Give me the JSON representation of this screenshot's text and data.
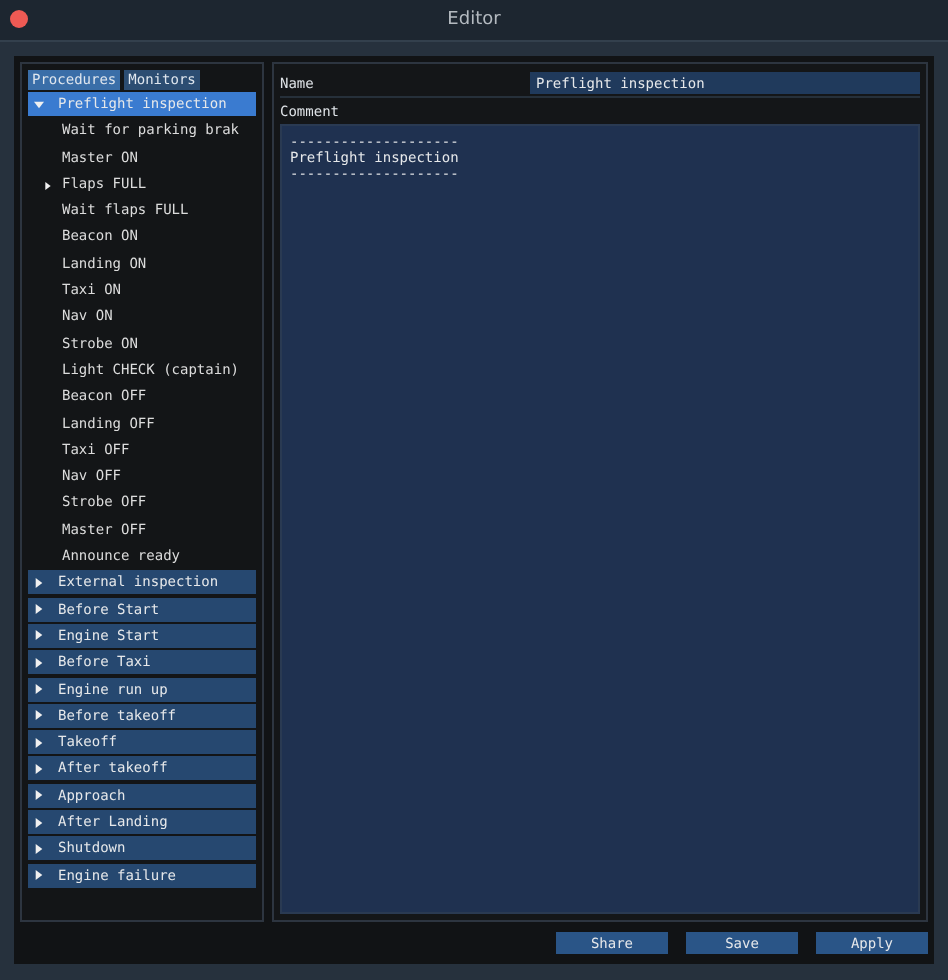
{
  "window": {
    "title": "Editor"
  },
  "tabs": [
    {
      "label": "Procedures",
      "selected": true
    },
    {
      "label": "Monitors",
      "selected": false
    }
  ],
  "tree": [
    {
      "label": "Preflight inspection",
      "expanded": true,
      "selected": true,
      "children": [
        {
          "label": "Wait for parking brak"
        },
        {
          "label": "Master ON"
        },
        {
          "label": "Flaps FULL",
          "expanded": false
        },
        {
          "label": "Wait flaps FULL"
        },
        {
          "label": "Beacon ON"
        },
        {
          "label": "Landing ON"
        },
        {
          "label": "Taxi ON"
        },
        {
          "label": "Nav ON"
        },
        {
          "label": "Strobe ON"
        },
        {
          "label": "Light CHECK (captain)"
        },
        {
          "label": "Beacon OFF"
        },
        {
          "label": "Landing OFF"
        },
        {
          "label": "Taxi OFF"
        },
        {
          "label": "Nav OFF"
        },
        {
          "label": "Strobe OFF"
        },
        {
          "label": "Master OFF"
        },
        {
          "label": "Announce ready"
        }
      ]
    },
    {
      "label": "External inspection",
      "expanded": false,
      "selected": false
    },
    {
      "label": "Before Start",
      "expanded": false,
      "selected": false
    },
    {
      "label": "Engine Start",
      "expanded": false,
      "selected": false
    },
    {
      "label": "Before Taxi",
      "expanded": false,
      "selected": false
    },
    {
      "label": "Engine run up",
      "expanded": false,
      "selected": false
    },
    {
      "label": "Before takeoff",
      "expanded": false,
      "selected": false
    },
    {
      "label": "Takeoff",
      "expanded": false,
      "selected": false
    },
    {
      "label": "After takeoff",
      "expanded": false,
      "selected": false
    },
    {
      "label": "Approach",
      "expanded": false,
      "selected": false
    },
    {
      "label": "After Landing",
      "expanded": false,
      "selected": false
    },
    {
      "label": "Shutdown",
      "expanded": false,
      "selected": false
    },
    {
      "label": "Engine failure",
      "expanded": false,
      "selected": false
    }
  ],
  "name_field": {
    "label": "Name",
    "value": "Preflight inspection"
  },
  "comment_field": {
    "label": "Comment",
    "value": "--------------------\nPreflight inspection\n--------------------"
  },
  "buttons": [
    "Share",
    "Save",
    "Apply"
  ]
}
